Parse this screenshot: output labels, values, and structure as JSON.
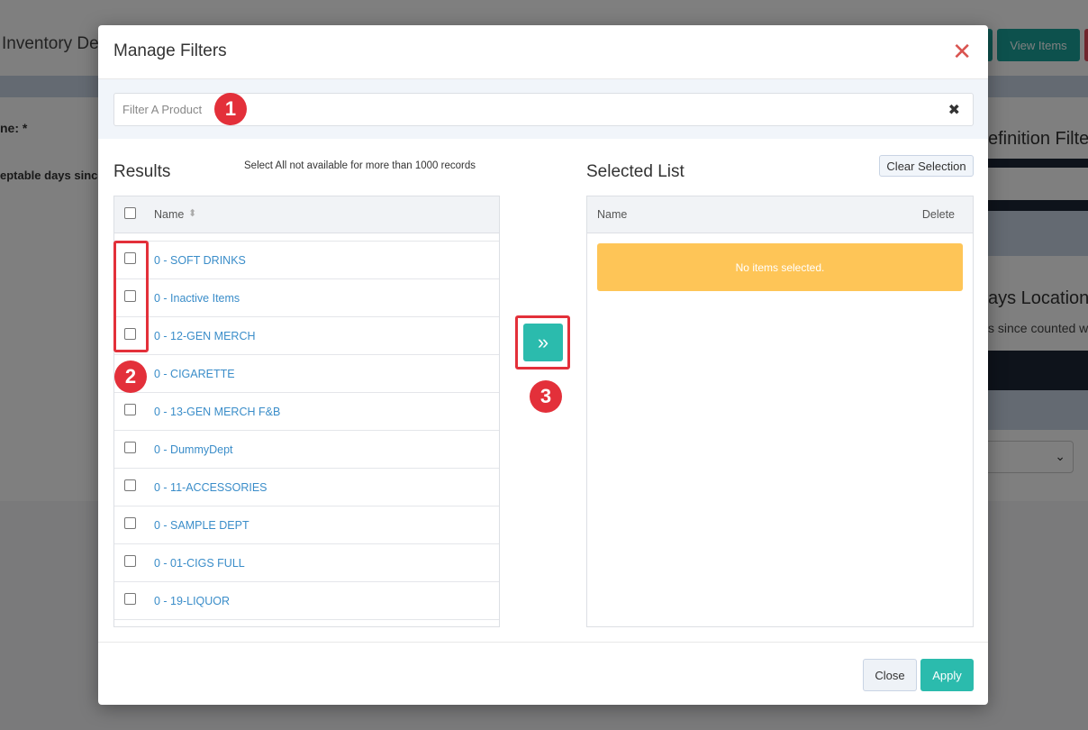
{
  "background": {
    "page_title": "Inventory De",
    "buttons": [
      "View Items"
    ],
    "label_1": "ne: *",
    "label_2": "eptable days since",
    "right_title_1": "efinition Filte",
    "right_title_2": "ays Location",
    "right_subtitle": "s since counted w"
  },
  "modal": {
    "title": "Manage Filters",
    "close_glyph": "✕",
    "filter": {
      "placeholder": "Filter A Product",
      "value": "",
      "clear_glyph": "✖"
    },
    "results": {
      "title": "Results",
      "note": "Select All not available for more than 1000 records",
      "column_name": "Name",
      "sort_glyph": "⬍",
      "items": [
        "0 - SOFT DRINKS",
        "0 - Inactive Items",
        "0 - 12-GEN MERCH",
        "0 - CIGARETTE",
        "0 - 13-GEN MERCH F&B",
        "0 - DummyDept",
        "0 - 11-ACCESSORIES",
        "0 - SAMPLE DEPT",
        "0 - 01-CIGS FULL",
        "0 - 19-LIQUOR"
      ]
    },
    "move_glyph": "»",
    "selected": {
      "title": "Selected List",
      "clear_label": "Clear Selection",
      "column_name": "Name",
      "column_delete": "Delete",
      "empty_message": "No items selected."
    },
    "footer": {
      "close_label": "Close",
      "apply_label": "Apply"
    }
  },
  "annotations": {
    "badge_1": "1",
    "badge_2": "2",
    "badge_3": "3",
    "color": "#e3303a"
  },
  "colors": {
    "accent": "#2bbbad",
    "link": "#3a8dc9",
    "warning": "#fec557",
    "danger": "#d9534f"
  }
}
